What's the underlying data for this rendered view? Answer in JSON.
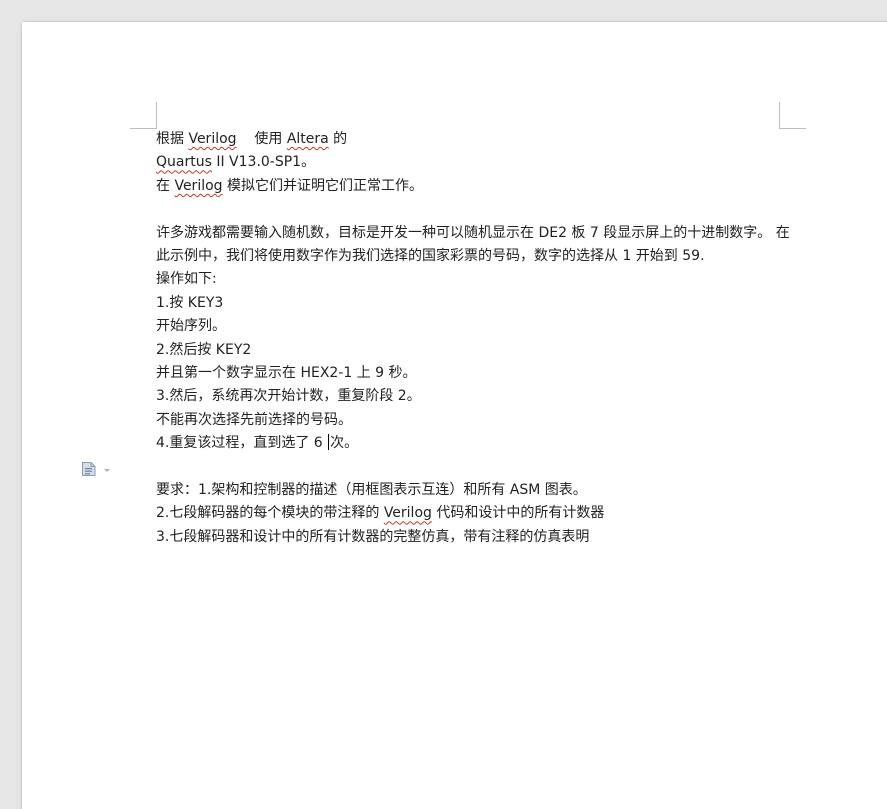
{
  "document": {
    "lines": [
      {
        "a": "根据 ",
        "b": "Verilog",
        "c": "    使用 ",
        "d": "Altera",
        "e": " 的"
      },
      {
        "a": "Quartus",
        "b": " II V13.0-SP1。"
      },
      {
        "a": "在 ",
        "b": "Verilog",
        "c": " 模拟它们并证明它们正常工作。"
      },
      {
        "text": "许多游戏都需要输入随机数，目标是开发一种可以随机显示在 DE2 板 7 段显示屏上的十进制数字。 在此示例中，我们将使用数字作为我们选择的国家彩票的号码，数字的选择从 1 开始到 59."
      },
      {
        "text": "操作如下:"
      },
      {
        "text": "1.按 KEY3"
      },
      {
        "text": "开始序列。"
      },
      {
        "text": "2.然后按 KEY2"
      },
      {
        "text": "并且第一个数字显示在 HEX2-1  上 9 秒。"
      },
      {
        "text": "3.然后，系统再次开始计数，重复阶段 2。"
      },
      {
        "text": "不能再次选择先前选择的号码。"
      },
      {
        "a": "4.重复该过程，直到选了 6 ",
        "b": "次。"
      },
      {
        "text": "要求：1.架构和控制器的描述（用框图表示互连）和所有 ASM 图表。"
      },
      {
        "a": "2.七段解码器的每个模块的带注释的 ",
        "b": "Verilog",
        "c": " 代码和设计中的所有计数器"
      },
      {
        "text": "3.七段解码器和设计中的所有计数器的完整仿真，带有注释的仿真表明"
      }
    ]
  },
  "colors": {
    "spellcheck": "#c0392b",
    "text": "#222222",
    "page": "#ffffff",
    "background": "#e6e6e6"
  },
  "icons": {
    "paragraph_handle": "document-lines-icon",
    "dropdown": "chevron-down-icon"
  }
}
